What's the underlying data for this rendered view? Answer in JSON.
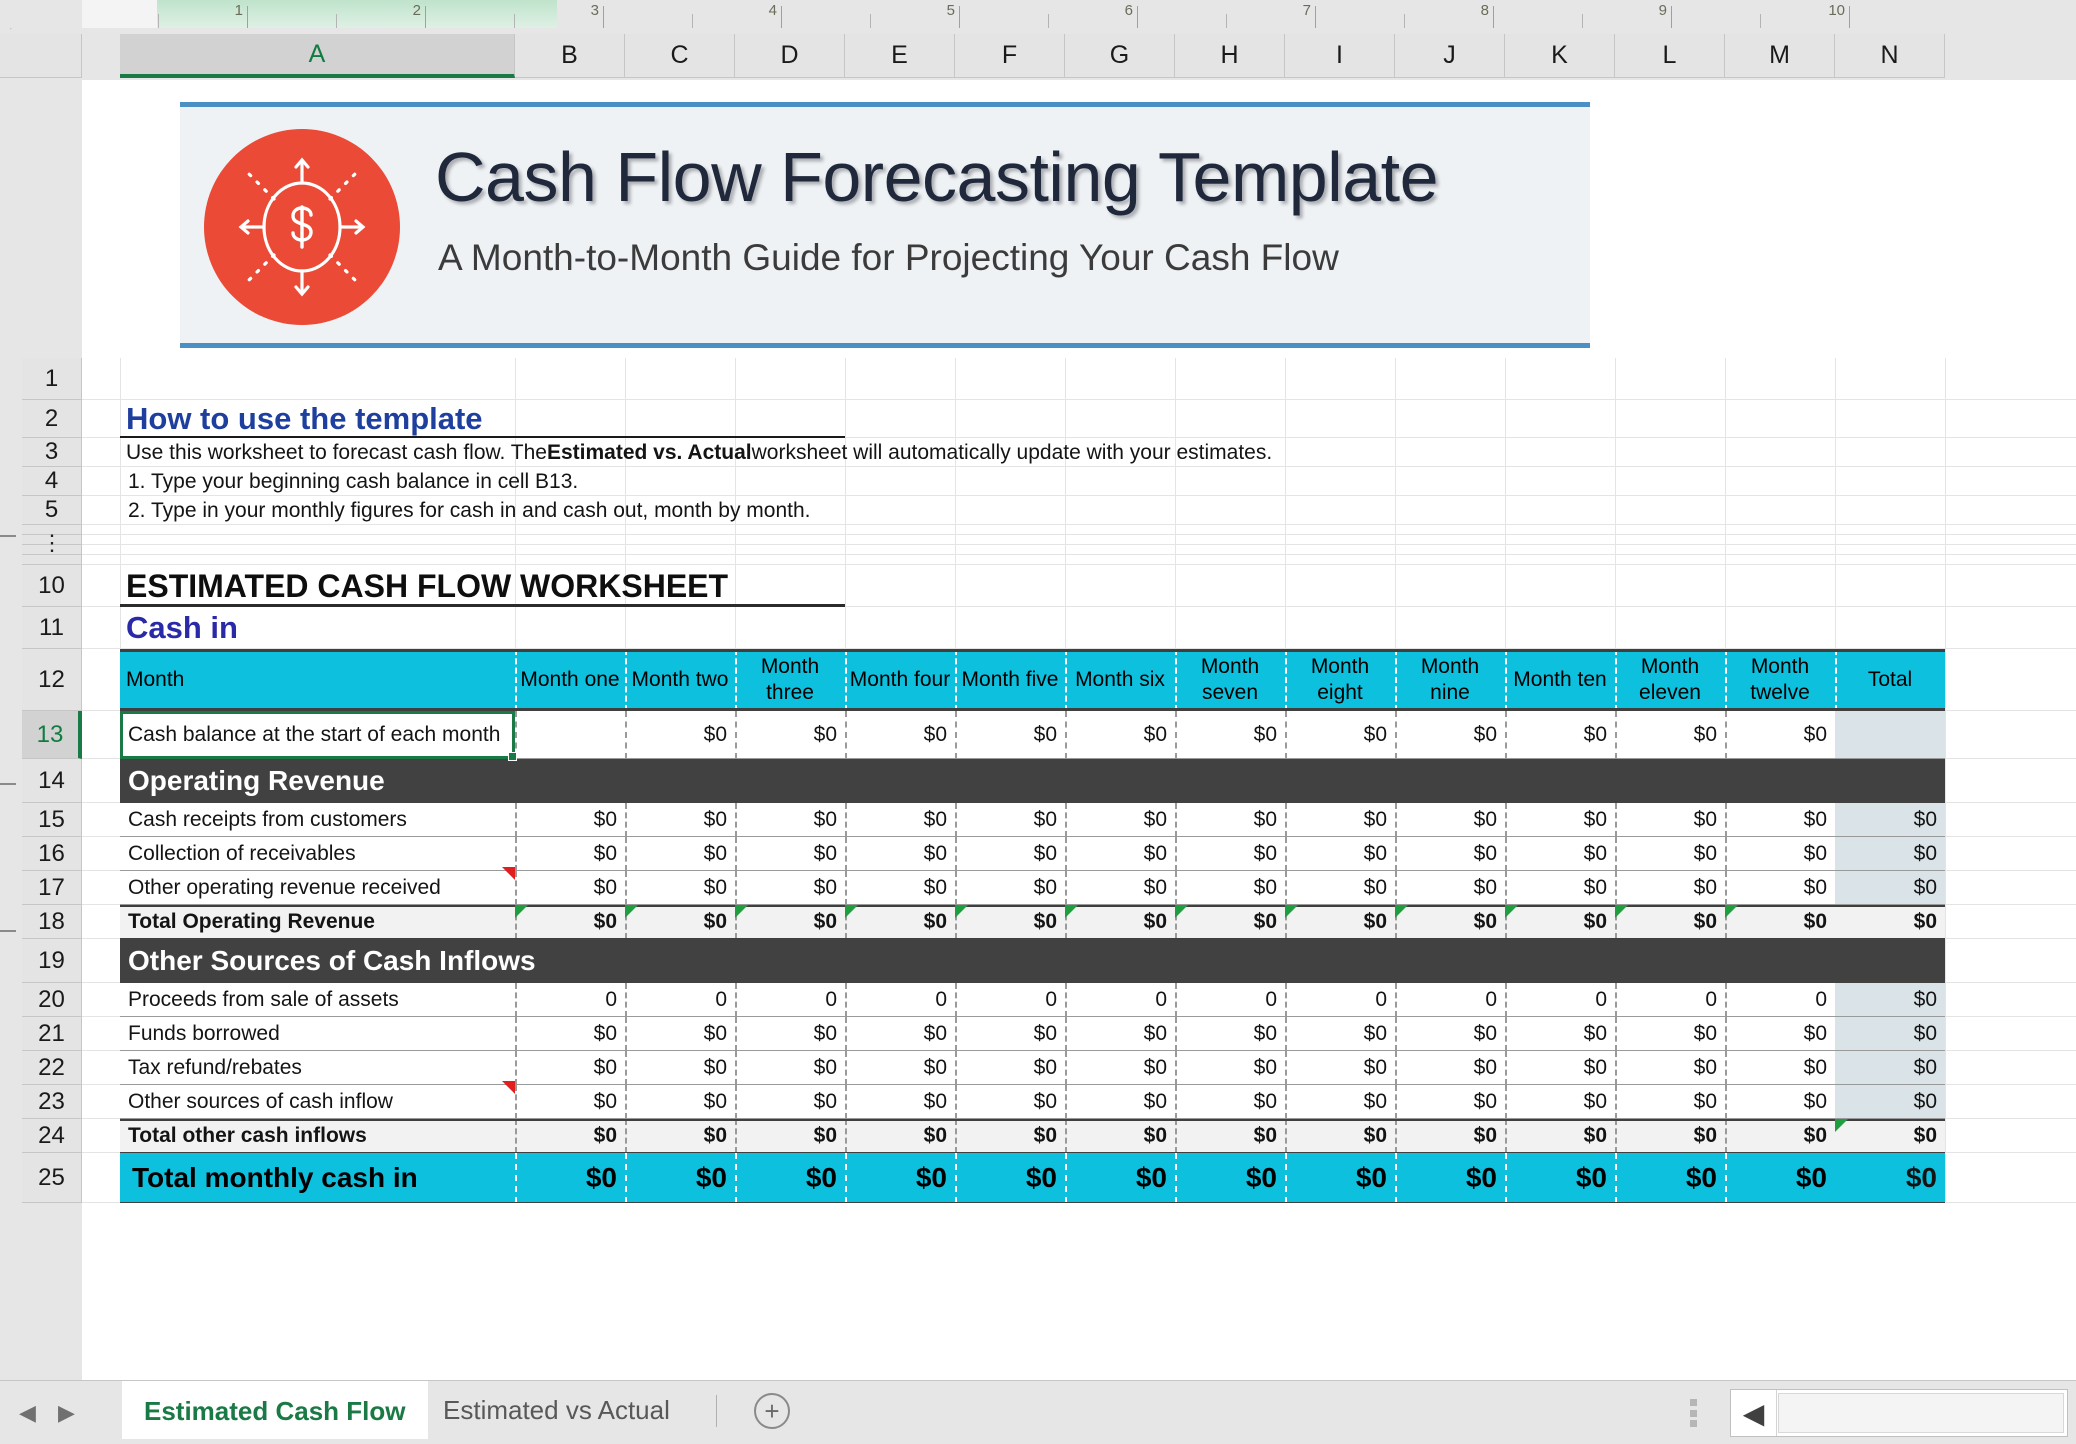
{
  "window": {
    "ruler_numbers": [
      "1",
      "2",
      "3",
      "4",
      "5",
      "6",
      "7",
      "8",
      "9",
      "10"
    ],
    "column_headers": [
      "A",
      "B",
      "C",
      "D",
      "E",
      "F",
      "G",
      "H",
      "I",
      "J",
      "K",
      "L",
      "M",
      "N"
    ],
    "selected_column": "A",
    "row_headers": [
      "1",
      "2",
      "3",
      "4",
      "5",
      "10",
      "11",
      "12",
      "13",
      "14",
      "15",
      "16",
      "17",
      "18",
      "19",
      "20",
      "21",
      "22",
      "23",
      "24",
      "25"
    ],
    "selected_row": "13",
    "collapsed_rows_marker": "⋮"
  },
  "banner": {
    "title": "Cash Flow Forecasting Template",
    "subtitle": "A Month-to-Month Guide for Projecting Your Cash Flow",
    "logo_icon": "dollar-circle-arrows-icon",
    "logo_color": "#ea4a36",
    "accent_color": "#4a90c4",
    "background_color": "#eef2f4"
  },
  "instructions": {
    "heading": "How to use the template",
    "heading_color": "#1f3f9e",
    "line1_a": "Use this worksheet to forecast cash flow. The ",
    "line1_bold": "Estimated vs. Actual",
    "line1_b": " worksheet will automatically update with your estimates.",
    "line2": "1. Type your beginning cash balance in cell B13.",
    "line3": "2. Type in your monthly figures for cash in and cash out, month by month."
  },
  "worksheet": {
    "title": "ESTIMATED CASH FLOW WORKSHEET",
    "section_label": "Cash in",
    "section_label_color": "#2a2aa8",
    "header_bg": "#0dc0de",
    "section_bg": "#414141",
    "total_col_bg": "#dae3e7"
  },
  "table": {
    "columns": [
      "Month",
      "Month one",
      "Month two",
      "Month three",
      "Month four",
      "Month five",
      "Month six",
      "Month seven",
      "Month eight",
      "Month nine",
      "Month ten",
      "Month eleven",
      "Month twelve",
      "Total"
    ],
    "rows": [
      {
        "kind": "data",
        "excel_row": "13",
        "label": "Cash balance at the start of each month",
        "values": [
          "",
          "$0",
          "$0",
          "$0",
          "$0",
          "$0",
          "$0",
          "$0",
          "$0",
          "$0",
          "$0",
          "$0"
        ],
        "total": ""
      },
      {
        "kind": "section",
        "excel_row": "14",
        "label": "Operating Revenue"
      },
      {
        "kind": "data",
        "excel_row": "15",
        "label": "Cash receipts from customers",
        "values": [
          "$0",
          "$0",
          "$0",
          "$0",
          "$0",
          "$0",
          "$0",
          "$0",
          "$0",
          "$0",
          "$0",
          "$0"
        ],
        "total": "$0"
      },
      {
        "kind": "data",
        "excel_row": "16",
        "label": "Collection of receivables",
        "values": [
          "$0",
          "$0",
          "$0",
          "$0",
          "$0",
          "$0",
          "$0",
          "$0",
          "$0",
          "$0",
          "$0",
          "$0"
        ],
        "total": "$0"
      },
      {
        "kind": "data",
        "excel_row": "17",
        "label": "Other operating revenue received",
        "values": [
          "$0",
          "$0",
          "$0",
          "$0",
          "$0",
          "$0",
          "$0",
          "$0",
          "$0",
          "$0",
          "$0",
          "$0"
        ],
        "total": "$0",
        "comment_marker_col": 1
      },
      {
        "kind": "total",
        "excel_row": "18",
        "label": "Total Operating Revenue",
        "values": [
          "$0",
          "$0",
          "$0",
          "$0",
          "$0",
          "$0",
          "$0",
          "$0",
          "$0",
          "$0",
          "$0",
          "$0"
        ],
        "total": "$0",
        "error_markers": true
      },
      {
        "kind": "section",
        "excel_row": "19",
        "label": "Other Sources of Cash Inflows"
      },
      {
        "kind": "data",
        "excel_row": "20",
        "label": "Proceeds from sale of assets",
        "values": [
          "0",
          "0",
          "0",
          "0",
          "0",
          "0",
          "0",
          "0",
          "0",
          "0",
          "0",
          "0"
        ],
        "total": "$0"
      },
      {
        "kind": "data",
        "excel_row": "21",
        "label": "Funds borrowed",
        "values": [
          "$0",
          "$0",
          "$0",
          "$0",
          "$0",
          "$0",
          "$0",
          "$0",
          "$0",
          "$0",
          "$0",
          "$0"
        ],
        "total": "$0"
      },
      {
        "kind": "data",
        "excel_row": "22",
        "label": "Tax refund/rebates",
        "values": [
          "$0",
          "$0",
          "$0",
          "$0",
          "$0",
          "$0",
          "$0",
          "$0",
          "$0",
          "$0",
          "$0",
          "$0"
        ],
        "total": "$0"
      },
      {
        "kind": "data",
        "excel_row": "23",
        "label": "Other sources of cash inflow",
        "values": [
          "$0",
          "$0",
          "$0",
          "$0",
          "$0",
          "$0",
          "$0",
          "$0",
          "$0",
          "$0",
          "$0",
          "$0"
        ],
        "total": "$0",
        "comment_marker_col": 1
      },
      {
        "kind": "total",
        "excel_row": "24",
        "label": "Total other cash inflows",
        "values": [
          "$0",
          "$0",
          "$0",
          "$0",
          "$0",
          "$0",
          "$0",
          "$0",
          "$0",
          "$0",
          "$0",
          "$0"
        ],
        "total": "$0",
        "error_markers_total": true
      },
      {
        "kind": "grandtotal",
        "excel_row": "25",
        "label": "Total monthly cash in",
        "values": [
          "$0",
          "$0",
          "$0",
          "$0",
          "$0",
          "$0",
          "$0",
          "$0",
          "$0",
          "$0",
          "$0",
          "$0"
        ],
        "total": "$0"
      }
    ]
  },
  "tabs": {
    "sheets": [
      {
        "label": "Estimated Cash Flow",
        "active": true
      },
      {
        "label": "Estimated vs Actual",
        "active": false
      }
    ],
    "add_label": "+",
    "nav_prev": "◀",
    "nav_next": "▶",
    "scroll_left": "◀"
  }
}
